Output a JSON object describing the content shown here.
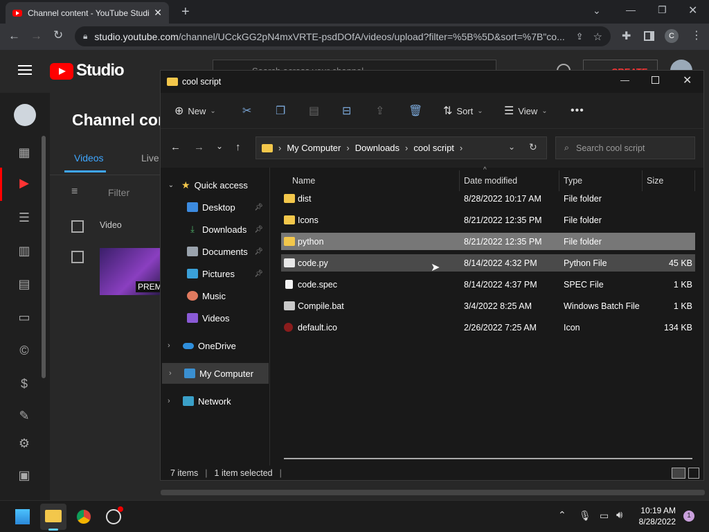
{
  "browser": {
    "tab_title": "Channel content - YouTube Studio",
    "url_host": "studio.youtube.com",
    "url_path": "/channel/UCckGG2pN4mxVRTE-psdDOfA/videos/upload?filter=%5B%5D&sort=%7B\"co...",
    "profile_initial": "C"
  },
  "studio": {
    "logo_text": "Studio",
    "search_placeholder": "Search across your channel",
    "create_label": "CREATE",
    "page_title": "Channel content",
    "tabs": [
      "Videos",
      "Live"
    ],
    "filter_label": "Filter",
    "col_video": "Video",
    "premiere_badge": "PREM"
  },
  "explorer": {
    "window_title": "cool script",
    "toolbar": {
      "new": "New",
      "sort": "Sort",
      "view": "View"
    },
    "breadcrumb": [
      "My Computer",
      "Downloads",
      "cool script"
    ],
    "search_placeholder": "Search cool script",
    "nav": {
      "quick_access": "Quick access",
      "pinned": [
        "Desktop",
        "Downloads",
        "Documents",
        "Pictures"
      ],
      "others": [
        "Music",
        "Videos"
      ],
      "onedrive": "OneDrive",
      "my_computer": "My Computer",
      "network": "Network"
    },
    "columns": {
      "name": "Name",
      "date": "Date modified",
      "type": "Type",
      "size": "Size"
    },
    "files": [
      {
        "name": "dist",
        "date": "8/28/2022 10:17 AM",
        "type": "File folder",
        "size": ""
      },
      {
        "name": "Icons",
        "date": "8/21/2022 12:35 PM",
        "type": "File folder",
        "size": ""
      },
      {
        "name": "python",
        "date": "8/21/2022 12:35 PM",
        "type": "File folder",
        "size": ""
      },
      {
        "name": "code.py",
        "date": "8/14/2022 4:32 PM",
        "type": "Python File",
        "size": "45 KB"
      },
      {
        "name": "code.spec",
        "date": "8/14/2022 4:37 PM",
        "type": "SPEC File",
        "size": "1 KB"
      },
      {
        "name": "Compile.bat",
        "date": "3/4/2022 8:25 AM",
        "type": "Windows Batch File",
        "size": "1 KB"
      },
      {
        "name": "default.ico",
        "date": "2/26/2022 7:25 AM",
        "type": "Icon",
        "size": "134 KB"
      }
    ],
    "status": {
      "items": "7 items",
      "selected": "1 item selected"
    }
  },
  "taskbar": {
    "time": "10:19 AM",
    "date": "8/28/2022",
    "notif_count": "1"
  },
  "colors": {
    "accent": "#3ea6ff",
    "yt_red": "#ff0000",
    "folder": "#f3c74b",
    "selected_row": "#777777",
    "hover_row": "#4a4a4a"
  }
}
